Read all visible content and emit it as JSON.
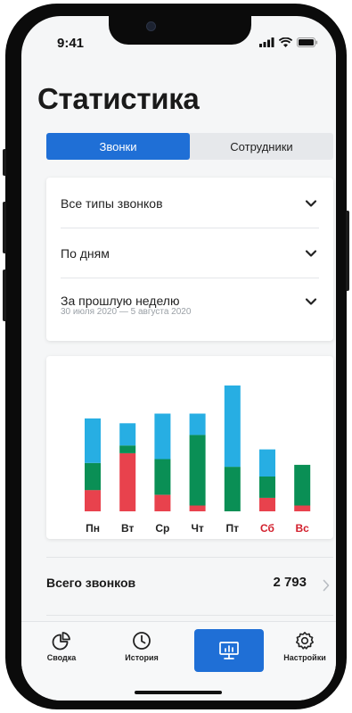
{
  "status_bar": {
    "time": "9:41"
  },
  "page": {
    "title": "Статистика"
  },
  "segments": [
    {
      "label": "Звонки",
      "active": true
    },
    {
      "label": "Сотрудники",
      "active": false
    }
  ],
  "filters": [
    {
      "label": "Все типы звонков",
      "sub": ""
    },
    {
      "label": "По дням",
      "sub": ""
    },
    {
      "label": "За прошлую неделю",
      "sub": "30 июля 2020 — 5 августа 2020"
    }
  ],
  "colors": {
    "accent": "#1f6fd6",
    "series_red": "#e8424d",
    "series_green": "#0a8f55",
    "series_blue": "#27aee3",
    "weekend_label": "#d21f2c"
  },
  "chart_data": {
    "type": "bar",
    "stacked": true,
    "categories": [
      "Пн",
      "Вт",
      "Ср",
      "Чт",
      "Пт",
      "Сб",
      "Вс"
    ],
    "weekend_categories": [
      "Сб",
      "Вс"
    ],
    "series": [
      {
        "values": [
          22,
          60,
          17,
          6,
          0,
          14,
          6
        ]
      },
      {
        "values": [
          28,
          8,
          37,
          73,
          46,
          22,
          42
        ]
      },
      {
        "values": [
          46,
          23,
          47,
          22,
          84,
          28,
          0
        ]
      }
    ],
    "ylim": [
      0,
      130
    ],
    "grid": false,
    "legend": "none"
  },
  "summary": {
    "label": "Всего звонков",
    "value": "2 793"
  },
  "tabbar": [
    {
      "label": "Сводка",
      "icon": "pie-chart-icon",
      "active": false
    },
    {
      "label": "История",
      "icon": "clock-icon",
      "active": false
    },
    {
      "label": "",
      "icon": "monitor-chart-icon",
      "active": true
    },
    {
      "label": "Настройки",
      "icon": "gear-icon",
      "active": false
    }
  ]
}
